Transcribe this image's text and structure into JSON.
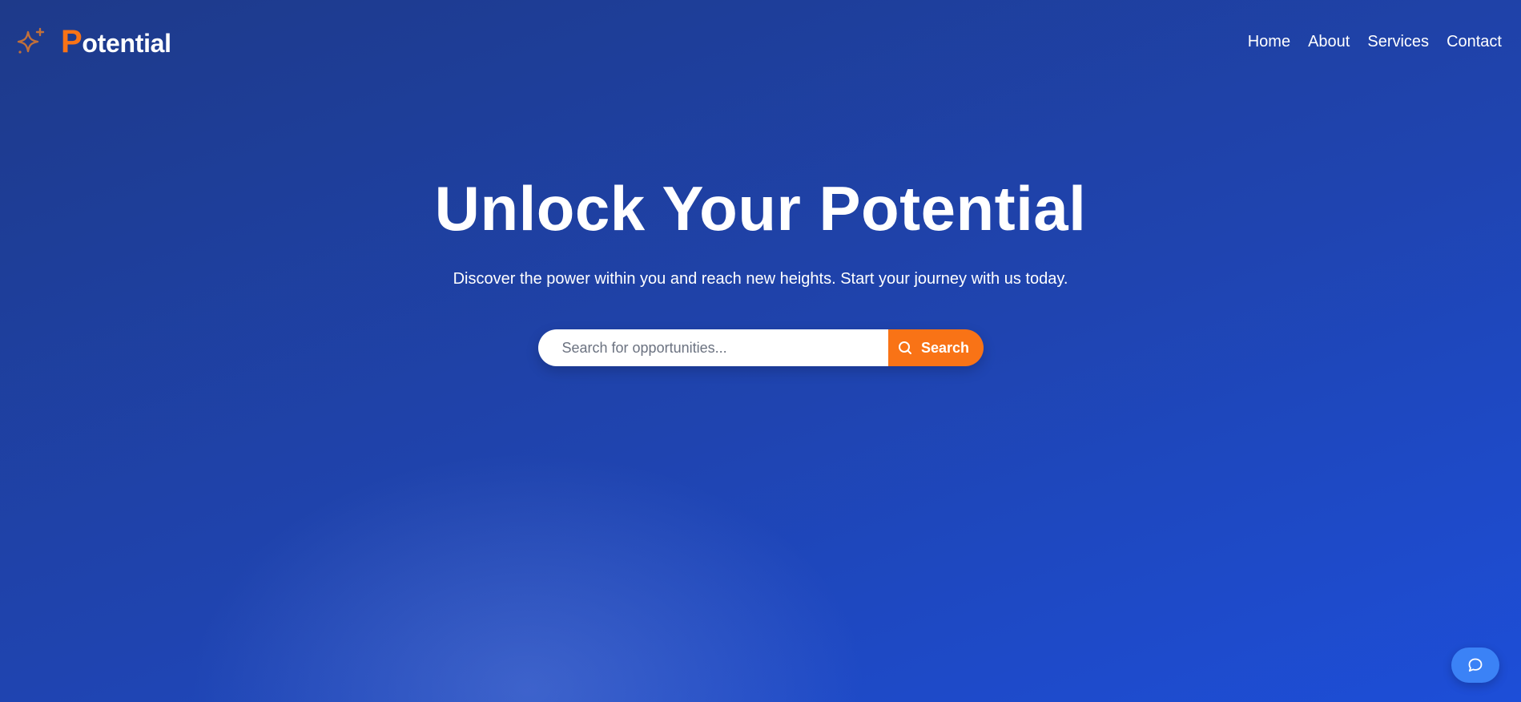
{
  "brand": {
    "initial": "P",
    "rest": "otential",
    "icon": "sparkle-icon",
    "accent_color": "#f97316"
  },
  "nav": {
    "items": [
      {
        "label": "Home"
      },
      {
        "label": "About"
      },
      {
        "label": "Services"
      },
      {
        "label": "Contact"
      }
    ]
  },
  "hero": {
    "title": "Unlock Your Potential",
    "subtitle": "Discover the power within you and reach new heights. Start your journey with us today."
  },
  "search": {
    "placeholder": "Search for opportunities...",
    "value": "",
    "button_label": "Search",
    "button_icon": "search-icon",
    "button_color": "#f97316"
  },
  "chat": {
    "icon": "chat-bubble-icon",
    "color": "#3b82f6"
  }
}
